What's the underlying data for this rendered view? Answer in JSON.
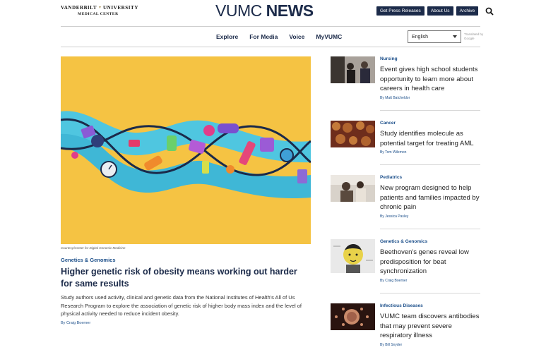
{
  "header": {
    "logo_line1_left": "VANDERBILT",
    "logo_line1_right": "UNIVERSITY",
    "logo_line2": "MEDICAL CENTER",
    "masthead_regular": "VUMC ",
    "masthead_bold": "NEWS",
    "buttons": [
      "Get Press Releases",
      "About Us",
      "Archive"
    ]
  },
  "nav": {
    "items": [
      "Explore",
      "For Media",
      "Voice",
      "MyVUMC"
    ]
  },
  "language": {
    "selected": "English",
    "translated_note": "Translated by Google"
  },
  "feature": {
    "credit": "Courtesy/Center for Digital Genomic Medicine",
    "category": "Genetics & Genomics",
    "title": "Higher genetic risk of obesity means working out harder for same results",
    "summary": "Study authors used activity, clinical and genetic data from the National Institutes of Health's All of Us Research Program to explore the association of genetic risk of higher body mass index and the level of physical activity needed to reduce incident obesity.",
    "byline": "By Craig Boerner"
  },
  "stories": [
    {
      "category": "Nursing",
      "title": "Event gives high school students opportunity to learn more about careers in health care",
      "byline": "By Matt Batcheldor",
      "thumb_colors": [
        "#3b3530",
        "#a8a19a"
      ]
    },
    {
      "category": "Cancer",
      "title": "Study identifies molecule as potential target for treating AML",
      "byline": "By Tom Wilemon",
      "thumb_colors": [
        "#6e2d1c",
        "#c47a3a"
      ]
    },
    {
      "category": "Pediatrics",
      "title": "New program designed to help patients and families impacted by chronic pain",
      "byline": "By Jessica Pasley",
      "thumb_colors": [
        "#4a3a30",
        "#d8d2ca"
      ]
    },
    {
      "category": "Genetics & Genomics",
      "title": "Beethoven's genes reveal low predisposition for beat synchronization",
      "byline": "By Craig Boerner",
      "thumb_colors": [
        "#8a8a8a",
        "#e8d24a"
      ]
    },
    {
      "category": "Infectious Diseases",
      "title": "VUMC team discovers antibodies that may prevent severe respiratory illness",
      "byline": "By Bill Snyder",
      "thumb_colors": [
        "#2a1410",
        "#c98a6a"
      ]
    }
  ]
}
